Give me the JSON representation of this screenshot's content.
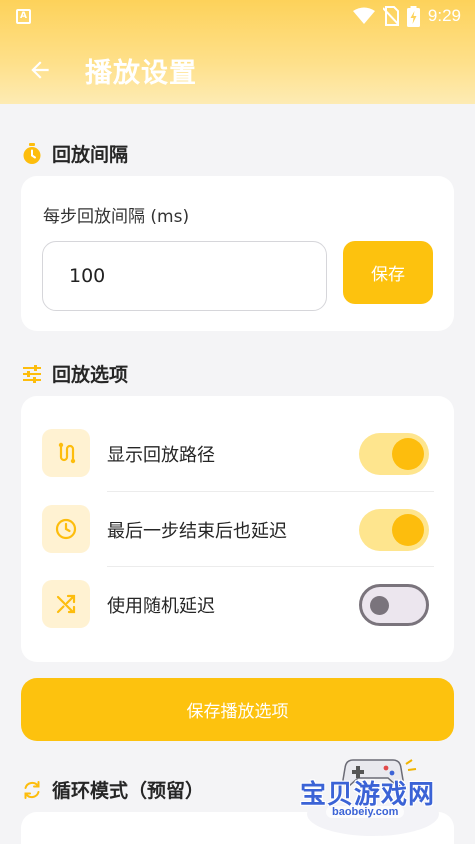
{
  "status_bar": {
    "time": "9:29"
  },
  "app_bar": {
    "title": "播放设置"
  },
  "interval_section": {
    "heading": "回放间隔",
    "field_label": "每步回放间隔 (ms)",
    "input_value": "100",
    "save_label": "保存"
  },
  "options_section": {
    "heading": "回放选项",
    "options": [
      {
        "label": "显示回放路径",
        "icon": "route-icon",
        "enabled": true
      },
      {
        "label": "最后一步结束后也延迟",
        "icon": "clock-icon",
        "enabled": true
      },
      {
        "label": "使用随机延迟",
        "icon": "shuffle-icon",
        "enabled": false
      }
    ],
    "save_label": "保存播放选项"
  },
  "loop_section": {
    "heading": "循环模式（预留）"
  },
  "watermark": {
    "text": "宝贝游戏网",
    "url": "baobeiy.com"
  },
  "colors": {
    "accent": "#fdc20e",
    "accent_light": "#fee58e",
    "icon_bg": "#fff2d2"
  }
}
